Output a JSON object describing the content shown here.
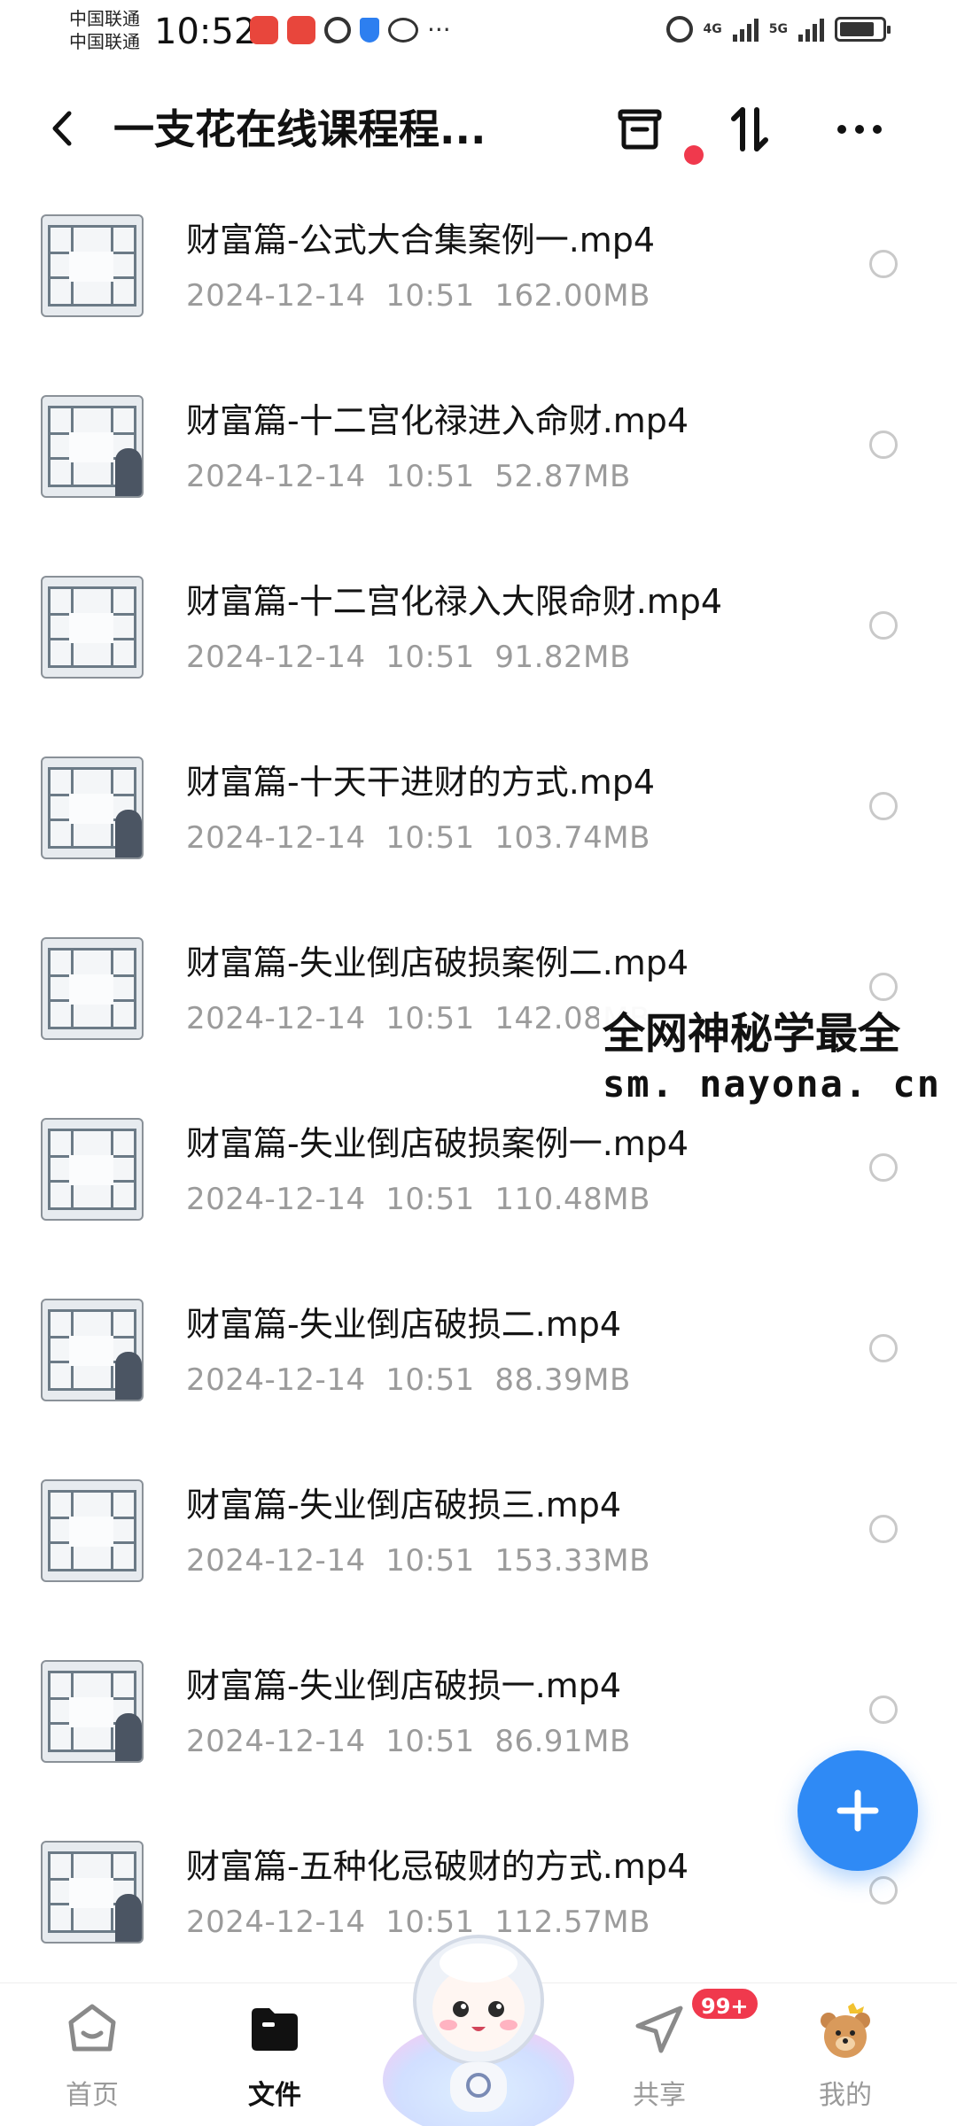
{
  "status_bar": {
    "carrier_1": "中国联通",
    "carrier_2": "中国联通",
    "time": "10:52",
    "net_1": "4G",
    "net_2": "5G"
  },
  "header": {
    "title": "一支花在线课程程...",
    "icons": [
      "back-icon",
      "archive-icon",
      "sort-icon",
      "more-icon"
    ],
    "notification_dot_color": "#f0394d"
  },
  "files": [
    {
      "name": "财富篇-公式大合集案例一.mp4",
      "date": "2024-12-14",
      "time": "10:51",
      "size": "162.00MB"
    },
    {
      "name": "财富篇-十二宫化禄进入命财.mp4",
      "date": "2024-12-14",
      "time": "10:51",
      "size": "52.87MB"
    },
    {
      "name": "财富篇-十二宫化禄入大限命财.mp4",
      "date": "2024-12-14",
      "time": "10:51",
      "size": "91.82MB"
    },
    {
      "name": "财富篇-十天干进财的方式.mp4",
      "date": "2024-12-14",
      "time": "10:51",
      "size": "103.74MB"
    },
    {
      "name": "财富篇-失业倒店破损案例二.mp4",
      "date": "2024-12-14",
      "time": "10:51",
      "size": "142.08MB"
    },
    {
      "name": "财富篇-失业倒店破损案例一.mp4",
      "date": "2024-12-14",
      "time": "10:51",
      "size": "110.48MB"
    },
    {
      "name": "财富篇-失业倒店破损二.mp4",
      "date": "2024-12-14",
      "time": "10:51",
      "size": "88.39MB"
    },
    {
      "name": "财富篇-失业倒店破损三.mp4",
      "date": "2024-12-14",
      "time": "10:51",
      "size": "153.33MB"
    },
    {
      "name": "财富篇-失业倒店破损一.mp4",
      "date": "2024-12-14",
      "time": "10:51",
      "size": "86.91MB"
    },
    {
      "name": "财富篇-五种化忌破财的方式.mp4",
      "date": "2024-12-14",
      "time": "10:51",
      "size": "112.57MB"
    }
  ],
  "watermark": {
    "line1": "全网神秘学最全",
    "line2": "sm. nayona. cn"
  },
  "bottom_nav": {
    "items": [
      {
        "label": "首页",
        "icon": "home-icon",
        "active": false
      },
      {
        "label": "文件",
        "icon": "folder-icon",
        "active": true
      },
      {
        "label": "",
        "icon": "mascot-icon",
        "active": false
      },
      {
        "label": "共享",
        "icon": "paper-plane-icon",
        "active": false
      },
      {
        "label": "我的",
        "icon": "bear-avatar-icon",
        "active": false
      }
    ],
    "share_badge": "99+"
  },
  "colors": {
    "accent": "#2f8af5",
    "badge": "#f0394d",
    "meta_text": "#9b9b9b"
  }
}
